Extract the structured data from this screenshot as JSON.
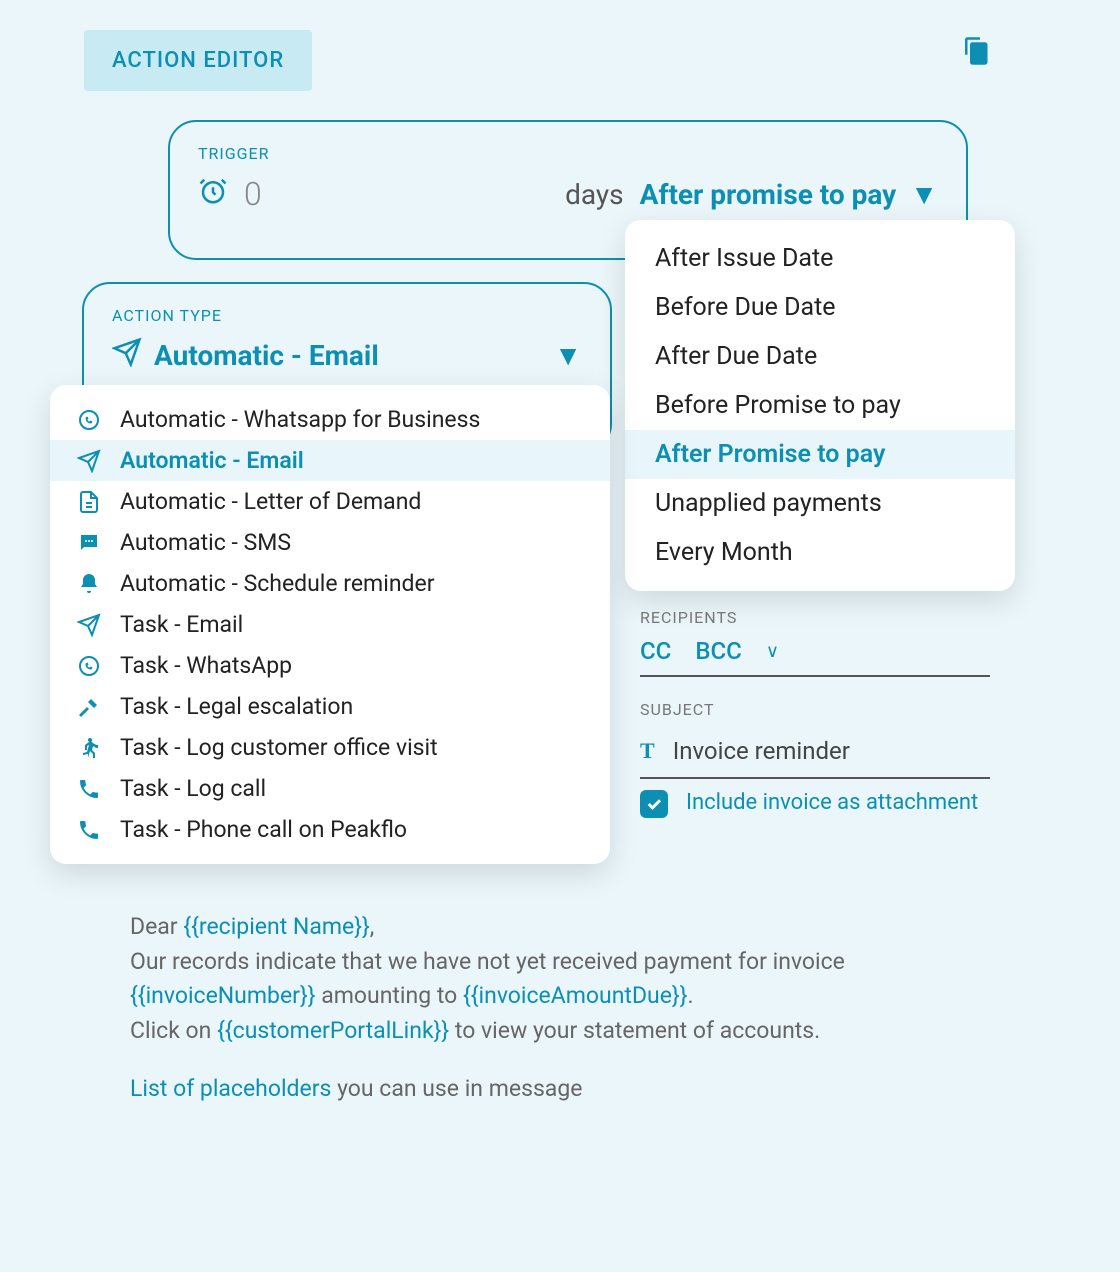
{
  "header": {
    "title": "ACTION EDITOR"
  },
  "trigger": {
    "label": "TRIGGER",
    "days_value": "0",
    "days_label": "days",
    "selected": "After promise to pay",
    "options": [
      {
        "label": "After Issue Date",
        "selected": false
      },
      {
        "label": "Before Due Date",
        "selected": false
      },
      {
        "label": "After Due Date",
        "selected": false
      },
      {
        "label": "Before Promise to pay",
        "selected": false
      },
      {
        "label": "After Promise to pay",
        "selected": true
      },
      {
        "label": "Unapplied payments",
        "selected": false
      },
      {
        "label": "Every Month",
        "selected": false
      }
    ]
  },
  "action": {
    "label": "ACTION TYPE",
    "selected": "Automatic - Email",
    "options": [
      {
        "icon": "whatsapp-icon",
        "label": "Automatic - Whatsapp for Business",
        "selected": false
      },
      {
        "icon": "send-icon",
        "label": "Automatic - Email",
        "selected": true
      },
      {
        "icon": "document-icon",
        "label": "Automatic - Letter of Demand",
        "selected": false
      },
      {
        "icon": "sms-icon",
        "label": "Automatic - SMS",
        "selected": false
      },
      {
        "icon": "bell-icon",
        "label": "Automatic - Schedule reminder",
        "selected": false
      },
      {
        "icon": "send-icon",
        "label": "Task - Email",
        "selected": false
      },
      {
        "icon": "whatsapp-icon",
        "label": "Task - WhatsApp",
        "selected": false
      },
      {
        "icon": "gavel-icon",
        "label": "Task - Legal escalation",
        "selected": false
      },
      {
        "icon": "walk-icon",
        "label": "Task - Log customer office visit",
        "selected": false
      },
      {
        "icon": "phone-icon",
        "label": "Task - Log call",
        "selected": false
      },
      {
        "icon": "phone-icon",
        "label": "Task - Phone call on Peakflo",
        "selected": false
      }
    ]
  },
  "recipients": {
    "label": "RECIPIENTS",
    "cc": "CC",
    "bcc": "BCC"
  },
  "subject": {
    "label": "SUBJECT",
    "value": "Invoice reminder"
  },
  "attachment": {
    "label": "Include invoice as attachment",
    "checked": true
  },
  "message": {
    "greeting_prefix": "Dear ",
    "greeting_placeholder": "{{recipient Name}}",
    "greeting_suffix": ",",
    "line2a": "Our records indicate that we have not yet received payment for invoice ",
    "ph_invoice": "{{invoiceNumber}}",
    "line2b": " amounting to ",
    "ph_amount": "{{invoiceAmountDue}}",
    "line2c": ".",
    "line3a": "Click on ",
    "ph_link": "{{customerPortalLink}}",
    "line3b": " to view your statement of accounts."
  },
  "placeholders_help": {
    "link": "List of placeholders",
    "rest": " you can use in message"
  }
}
